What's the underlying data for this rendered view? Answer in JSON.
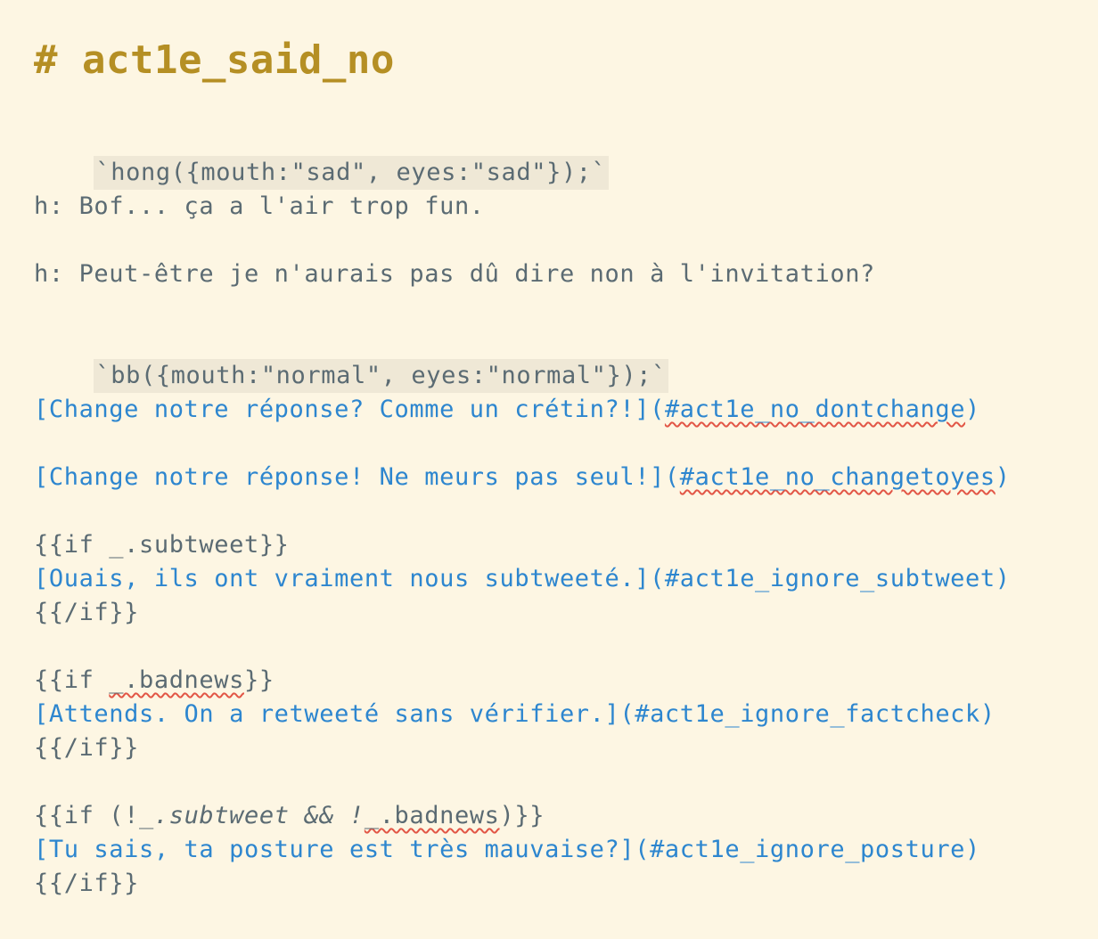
{
  "title": "# act1e_said_no",
  "lines": {
    "code1": "`hong({mouth:\"sad\", eyes:\"sad\"});`",
    "dialog1": "h: Bof... ça a l'air trop fun.",
    "dialog2": "h: Peut-être je n'aurais pas dû dire non à l'invitation?",
    "code2": "`bb({mouth:\"normal\", eyes:\"normal\"});`",
    "link1_text": "[Change notre réponse? Comme un crétin?!](",
    "link1_target": "#act1e_no_dontchange",
    "link1_close": ")",
    "link2_text": "[Change notre réponse! Ne meurs pas seul!](",
    "link2_target": "#act1e_no_changetoyes",
    "link2_close": ")",
    "if1_open": "{{if _.subtweet}}",
    "link3": "[Ouais, ils ont vraiment nous subtweeté.](#act1e_ignore_subtweet)",
    "if1_close": "{{/if}}",
    "if2_open_a": "{{if ",
    "if2_open_b": "_.badnews",
    "if2_open_c": "}}",
    "link4": "[Attends. On a retweeté sans vérifier.](#act1e_ignore_factcheck)",
    "if2_close": "{{/if}}",
    "if3_open_a": "{{if (!",
    "if3_open_b": "_.subtweet && !",
    "if3_open_c": "_.badnews",
    "if3_open_d": ")}}",
    "link5": "[Tu sais, ta posture est très mauvaise?](#act1e_ignore_posture)",
    "if3_close": "{{/if}}"
  }
}
